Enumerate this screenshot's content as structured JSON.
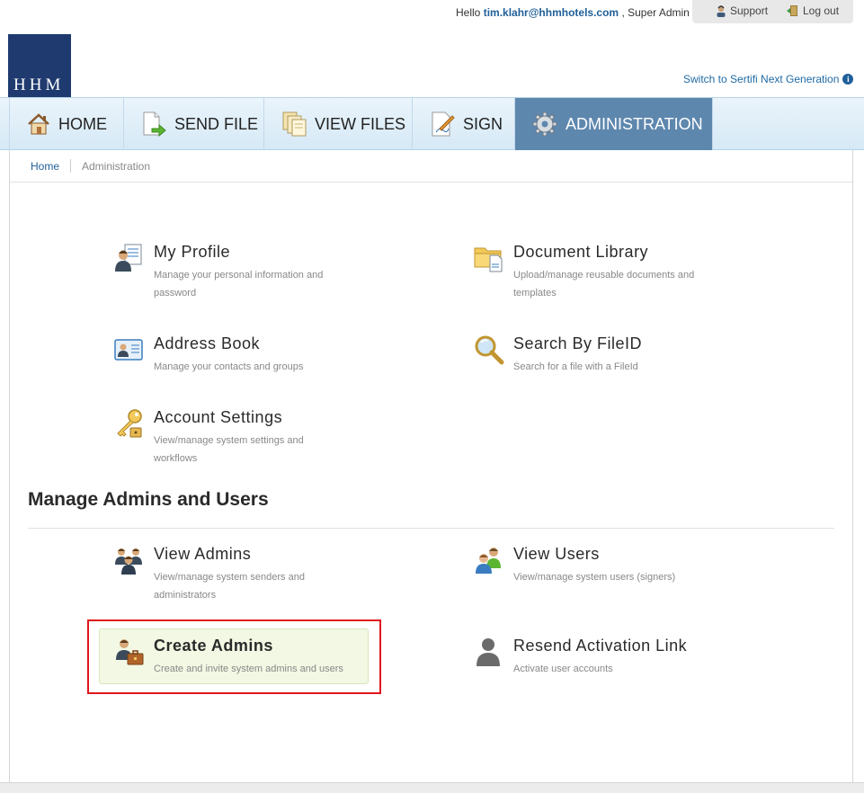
{
  "header": {
    "greeting_prefix": "Hello",
    "email": "tim.klahr@hhmhotels.com",
    "role": ", Super Admin",
    "support_label": "Support",
    "logout_label": "Log out",
    "logo_text": "HHM",
    "switch_label": "Switch to Sertifi Next Generation"
  },
  "nav": {
    "items": [
      {
        "label": "HOME",
        "icon": "house-icon"
      },
      {
        "label": "SEND FILE",
        "icon": "send-file-icon"
      },
      {
        "label": "VIEW FILES",
        "icon": "files-icon"
      },
      {
        "label": "SIGN",
        "icon": "sign-icon"
      },
      {
        "label": "ADMINISTRATION",
        "icon": "gear-icon",
        "active": true
      }
    ]
  },
  "breadcrumb": {
    "home": "Home",
    "current": "Administration"
  },
  "settings": {
    "items": [
      {
        "title": "My Profile",
        "desc": "Manage your personal information and password",
        "icon": "profile-icon"
      },
      {
        "title": "Document Library",
        "desc": "Upload/manage reusable documents and templates",
        "icon": "folder-icon"
      },
      {
        "title": "Address Book",
        "desc": "Manage your contacts and groups",
        "icon": "address-card-icon"
      },
      {
        "title": "Search By FileID",
        "desc": "Search for a file with a FileId",
        "icon": "magnifier-icon"
      },
      {
        "title": "Account Settings",
        "desc": "View/manage system settings and workflows",
        "icon": "keys-icon"
      }
    ]
  },
  "admins_section": {
    "heading": "Manage Admins and Users",
    "items": [
      {
        "title": "View Admins",
        "desc": "View/manage system senders and administrators",
        "icon": "admins-group-icon"
      },
      {
        "title": "View Users",
        "desc": "View/manage system users (signers)",
        "icon": "users-group-icon"
      },
      {
        "title": "Create Admins",
        "desc": "Create and invite system admins and users",
        "icon": "admin-briefcase-icon"
      },
      {
        "title": "Resend Activation Link",
        "desc": "Activate user accounts",
        "icon": "user-silhouette-icon"
      }
    ]
  },
  "colors": {
    "nav_active": "#5e87ae",
    "link": "#1f5f99",
    "highlight_bg": "#f2f8e3",
    "annotation_outline": "#e0161d",
    "logo_bg": "#1e3a6e"
  }
}
